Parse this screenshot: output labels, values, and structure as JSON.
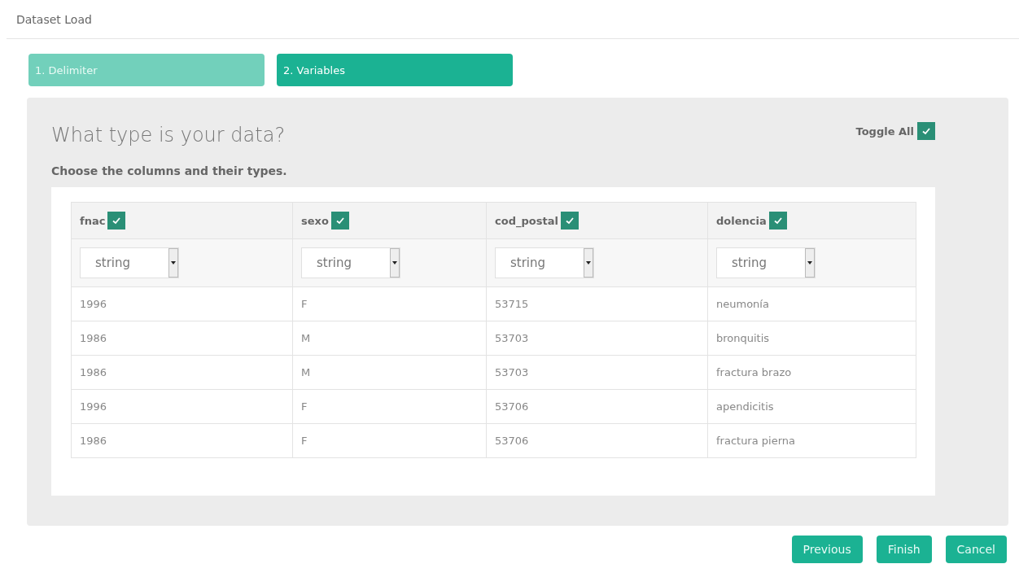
{
  "window": {
    "title": "Dataset Load"
  },
  "steps": [
    {
      "label": "1. Delimiter",
      "selected": false
    },
    {
      "label": "2. Variables",
      "selected": true
    }
  ],
  "panel": {
    "title": "What type is your data?",
    "subtitle": "Choose the columns and their types.",
    "toggle_all": {
      "label": "Toggle All",
      "checked": true
    }
  },
  "table": {
    "columns": [
      {
        "name": "fnac",
        "checked": true,
        "type": "string"
      },
      {
        "name": "sexo",
        "checked": true,
        "type": "string"
      },
      {
        "name": "cod_postal",
        "checked": true,
        "type": "string"
      },
      {
        "name": "dolencia",
        "checked": true,
        "type": "string"
      }
    ],
    "rows": [
      [
        "1996",
        "F",
        "53715",
        "neumonía"
      ],
      [
        "1986",
        "M",
        "53703",
        "bronquitis"
      ],
      [
        "1986",
        "M",
        "53703",
        "fractura brazo"
      ],
      [
        "1996",
        "F",
        "53706",
        "apendicitis"
      ],
      [
        "1986",
        "F",
        "53706",
        "fractura pierna"
      ]
    ]
  },
  "buttons": [
    "Previous",
    "Finish",
    "Cancel"
  ]
}
